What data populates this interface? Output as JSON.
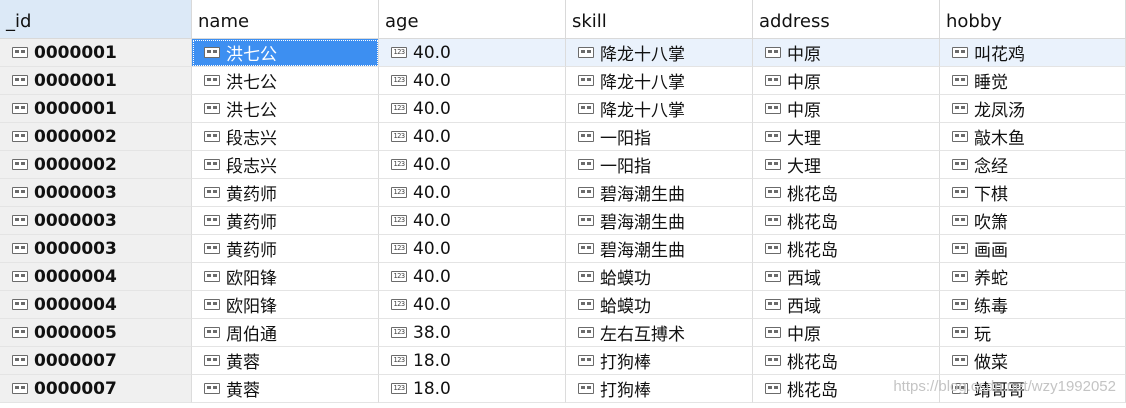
{
  "columns": [
    "_id",
    "name",
    "age",
    "skill",
    "address",
    "hobby"
  ],
  "rows": [
    {
      "_id": "0000001",
      "name": "洪七公",
      "age": "40.0",
      "skill": "降龙十八掌",
      "address": "中原",
      "hobby": "叫花鸡"
    },
    {
      "_id": "0000001",
      "name": "洪七公",
      "age": "40.0",
      "skill": "降龙十八掌",
      "address": "中原",
      "hobby": "睡觉"
    },
    {
      "_id": "0000001",
      "name": "洪七公",
      "age": "40.0",
      "skill": "降龙十八掌",
      "address": "中原",
      "hobby": "龙凤汤"
    },
    {
      "_id": "0000002",
      "name": "段志兴",
      "age": "40.0",
      "skill": "一阳指",
      "address": "大理",
      "hobby": "敲木鱼"
    },
    {
      "_id": "0000002",
      "name": "段志兴",
      "age": "40.0",
      "skill": "一阳指",
      "address": "大理",
      "hobby": "念经"
    },
    {
      "_id": "0000003",
      "name": "黄药师",
      "age": "40.0",
      "skill": "碧海潮生曲",
      "address": "桃花岛",
      "hobby": "下棋"
    },
    {
      "_id": "0000003",
      "name": "黄药师",
      "age": "40.0",
      "skill": "碧海潮生曲",
      "address": "桃花岛",
      "hobby": "吹箫"
    },
    {
      "_id": "0000003",
      "name": "黄药师",
      "age": "40.0",
      "skill": "碧海潮生曲",
      "address": "桃花岛",
      "hobby": "画画"
    },
    {
      "_id": "0000004",
      "name": "欧阳锋",
      "age": "40.0",
      "skill": "蛤蟆功",
      "address": "西域",
      "hobby": "养蛇"
    },
    {
      "_id": "0000004",
      "name": "欧阳锋",
      "age": "40.0",
      "skill": "蛤蟆功",
      "address": "西域",
      "hobby": "练毒"
    },
    {
      "_id": "0000005",
      "name": "周伯通",
      "age": "38.0",
      "skill": "左右互搏术",
      "address": "中原",
      "hobby": "玩"
    },
    {
      "_id": "0000007",
      "name": "黄蓉",
      "age": "18.0",
      "skill": "打狗棒",
      "address": "桃花岛",
      "hobby": "做菜"
    },
    {
      "_id": "0000007",
      "name": "黄蓉",
      "age": "18.0",
      "skill": "打狗棒",
      "address": "桃花岛",
      "hobby": "靖哥哥"
    }
  ],
  "selected": {
    "row": 0,
    "column": "name"
  },
  "sorted_column": "_id",
  "number_icon_text": "123",
  "watermark": "https://blog.csdn.net/wzy1992052",
  "colors": {
    "selected_bg": "#3d8ff1",
    "active_row_bg": "#eaf2fc",
    "sorted_header_bg": "#dce9f7",
    "id_column_bg": "#f0f0f0"
  }
}
